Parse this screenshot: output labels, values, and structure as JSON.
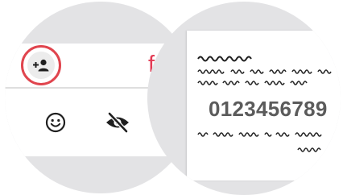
{
  "header": {
    "brand_text": "fran"
  },
  "toolbar": {
    "add_contact_icon": "person-add-icon"
  },
  "actions": [
    {
      "icon": "emoji-icon"
    },
    {
      "icon": "eye-off-icon"
    },
    {
      "icon": "more-vertical-icon"
    }
  ],
  "message": {
    "code": "0123456789"
  },
  "colors": {
    "accent": "#e33b54",
    "highlight_ring": "#e0454e",
    "background": "#e3e3e5",
    "icon": "#1f1f1f",
    "code_text": "#5b5b5b"
  }
}
